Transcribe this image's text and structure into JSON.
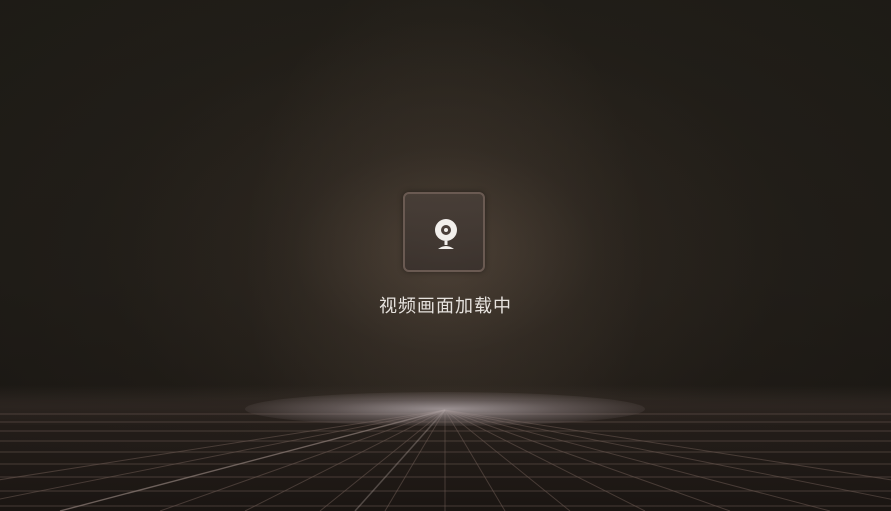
{
  "player": {
    "status_text": "视频画面加载中",
    "icon": "webcam-icon",
    "colors": {
      "background": "#1a1814",
      "icon": "#f2efec",
      "tile_border": "#6a5a52",
      "text": "#e6e2de"
    }
  }
}
